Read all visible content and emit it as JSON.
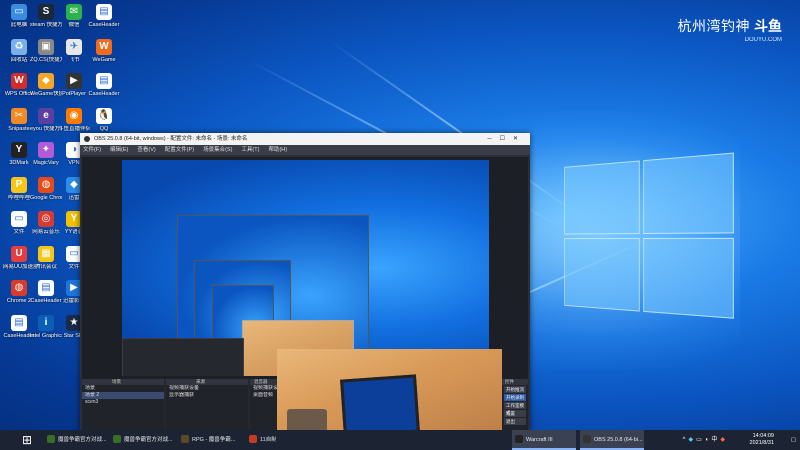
{
  "watermark": {
    "text": "杭州湾钓神",
    "logo": "斗鱼",
    "url": "DOUYU.COM"
  },
  "desktop_icons": [
    {
      "label": "此电脑",
      "color": "#3a8dde",
      "glyph": "▭"
    },
    {
      "label": "steam 快捷方式",
      "color": "#1b2838",
      "glyph": "S"
    },
    {
      "label": "微信",
      "color": "#2bb24c",
      "glyph": "✉"
    },
    {
      "label": "CaseHeader",
      "color": "#ffffff",
      "glyph": "▤"
    },
    {
      "label": "回收站",
      "color": "#7ab0e8",
      "glyph": "♻"
    },
    {
      "label": "ZQ.CS(快捷方式)",
      "color": "#888",
      "glyph": "▣"
    },
    {
      "label": "飞书",
      "color": "#e8e8e8",
      "glyph": "✈"
    },
    {
      "label": "WeGame",
      "color": "#f26b1d",
      "glyph": "W"
    },
    {
      "label": "WPS Office",
      "color": "#d42b2b",
      "glyph": "W"
    },
    {
      "label": "WeGame快捷方式",
      "color": "#f5a623",
      "glyph": "◆"
    },
    {
      "label": "PotPlayer",
      "color": "#333",
      "glyph": "▶"
    },
    {
      "label": "CaseHeader",
      "color": "#ffffff",
      "glyph": "▤"
    },
    {
      "label": "Snipaste",
      "color": "#f08a24",
      "glyph": "✂"
    },
    {
      "label": "eyou 快捷方式",
      "color": "#5a3fa0",
      "glyph": "e"
    },
    {
      "label": "斗鱼直播伴侣",
      "color": "#ff7a00",
      "glyph": "◉"
    },
    {
      "label": "QQ",
      "color": "#ffffff",
      "glyph": "🐧"
    },
    {
      "label": "3DMark",
      "color": "#222",
      "glyph": "Y"
    },
    {
      "label": "MagicVary",
      "color": "#b35ad6",
      "glyph": "✦"
    },
    {
      "label": "VPN",
      "color": "#ffffff",
      "glyph": "◑"
    },
    {
      "label": "Microsoft Edge",
      "color": "#1fa6a0",
      "glyph": "e"
    },
    {
      "label": "哔哩哔哩",
      "color": "#f5c518",
      "glyph": "P"
    },
    {
      "label": "Google Chrome",
      "color": "#e64a19",
      "glyph": "◍"
    },
    {
      "label": "迅雷",
      "color": "#2c8ce6",
      "glyph": "◆"
    },
    {
      "label": "向日葵",
      "color": "#f5c518",
      "glyph": "◈"
    },
    {
      "label": "文件",
      "color": "#ffffff",
      "glyph": "▭"
    },
    {
      "label": "网易云音乐",
      "color": "#d43c33",
      "glyph": "◎"
    },
    {
      "label": "YY语音",
      "color": "#f2c200",
      "glyph": "Y"
    },
    {
      "label": "文件",
      "color": "#ffffff",
      "glyph": "▭"
    },
    {
      "label": "网易UU加速器",
      "color": "#e43d3d",
      "glyph": "U"
    },
    {
      "label": "腾讯会议",
      "color": "#f5c518",
      "glyph": "▦"
    },
    {
      "label": "文件",
      "color": "#ffffff",
      "glyph": "▭"
    },
    {
      "label": "Google Chrome",
      "color": "#3b7bd8",
      "glyph": "◍"
    },
    {
      "label": "Chrome 2",
      "color": "#d93a2b",
      "glyph": "◍"
    },
    {
      "label": "CaseHeader",
      "color": "#ffffff",
      "glyph": "▤"
    },
    {
      "label": "迅雷影音",
      "color": "#1e78d7",
      "glyph": "▶"
    },
    {
      "label": "CaseHeader",
      "color": "#ffffff",
      "glyph": "▤"
    },
    {
      "label": "CaseHeader",
      "color": "#ffffff",
      "glyph": "▤"
    },
    {
      "label": "Intel Graphics",
      "color": "#0a5fb4",
      "glyph": "i"
    },
    {
      "label": "Star Sky",
      "color": "#1c2a4a",
      "glyph": "★"
    },
    {
      "label": "魔兽",
      "color": "#2a2a2a",
      "glyph": "W"
    }
  ],
  "obs": {
    "title": "OBS 25.0.8 (64-bit, windows) - 配置文件: 未命名 - 场景: 未命名",
    "menu": [
      "文件(F)",
      "编辑(E)",
      "查看(V)",
      "配置文件(P)",
      "场景集合(S)",
      "工具(T)",
      "帮助(H)"
    ],
    "docks": {
      "scenes": {
        "header": "场景",
        "items": [
          "场景",
          "场景 2",
          "scen3"
        ],
        "selected": 1
      },
      "sources": {
        "header": "来源",
        "items": [
          "视频捕获设备",
          "显示器捕获"
        ]
      },
      "mixer": {
        "header": "混音器",
        "items": [
          "视频捕获设备",
          "桌面音频"
        ]
      },
      "controls": {
        "header": "控件",
        "items": [
          "开始推流",
          "开始录制",
          "工作室模式",
          "设置",
          "退出"
        ]
      }
    }
  },
  "taskbar": {
    "start_icon": "windows-icon",
    "items": [
      {
        "label": "魔兽争霸官方对战...",
        "color": "#3a6d2a"
      },
      {
        "label": "魔兽争霸官方对战...",
        "color": "#3a6d2a"
      },
      {
        "label": "RPG - 魔兽争霸...",
        "color": "#5a4a2a"
      },
      {
        "label": "11自制...",
        "color": "#c23b22"
      },
      {
        "label": "Warcraft III",
        "color": "#222",
        "active": true
      },
      {
        "label": "OBS 25.0.8 (64-bi...",
        "color": "#333",
        "active": true
      }
    ],
    "time": "14:04:09",
    "date": "2021/8/31"
  }
}
